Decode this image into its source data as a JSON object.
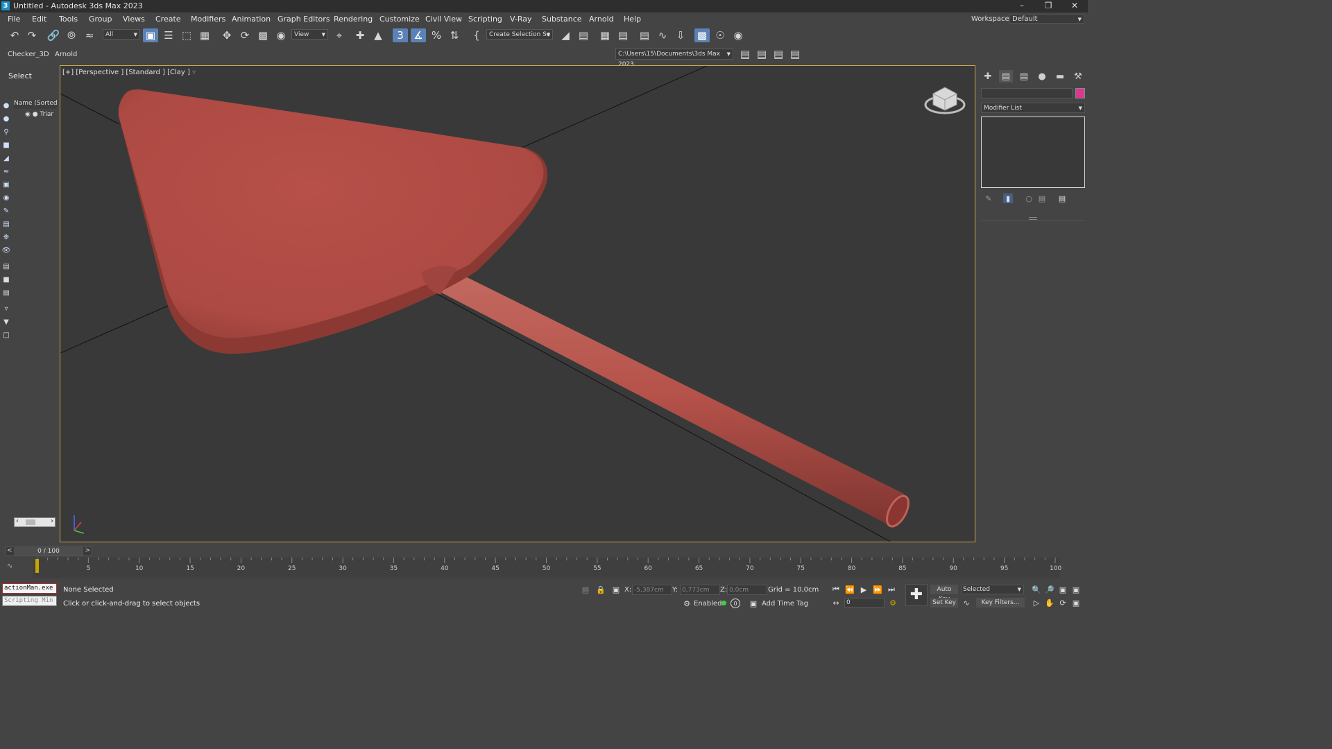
{
  "window": {
    "title": "Untitled - Autodesk 3ds Max 2023",
    "logo": "3",
    "controls": [
      "minimize-icon",
      "restore-icon",
      "close-icon"
    ]
  },
  "menu": {
    "items": [
      "File",
      "Edit",
      "Tools",
      "Group",
      "Views",
      "Create",
      "Modifiers",
      "Animation",
      "Graph Editors",
      "Rendering",
      "Customize",
      "Civil View",
      "Scripting",
      "V-Ray",
      "Substance",
      "Arnold",
      "Help"
    ],
    "workspaces_label": "Workspaces:",
    "workspace_value": "Default"
  },
  "toolbar": {
    "filter_value": "All",
    "refcoord_value": "View",
    "named_selection": "Create Selection Se",
    "snap_value": "3"
  },
  "row2": {
    "tabs": [
      "Checker_3D",
      "Arnold"
    ],
    "project_path": "C:\\Users\\15\\Documents\\3ds Max 2023"
  },
  "scene_explorer": {
    "mode_label": "Select",
    "column_header": "Name (Sorted A",
    "items": [
      "Triar"
    ]
  },
  "viewport": {
    "label": "[+] [Perspective ] [Standard ] [Clay ]",
    "object_color": "#b2524a",
    "border_color": "#c9a64a"
  },
  "command_panel": {
    "modifier_list": "Modifier List",
    "object_color": "#d63a8e"
  },
  "timeline": {
    "current": "0 / 100",
    "ticks": [
      "5",
      "10",
      "15",
      "20",
      "25",
      "30",
      "35",
      "40",
      "45",
      "50",
      "55",
      "60",
      "65",
      "70",
      "75",
      "80",
      "85",
      "90",
      "95",
      "100"
    ],
    "prev": "<",
    "next": ">"
  },
  "statusbar": {
    "maxscript_line1": "actionMan.exe",
    "maxscript_line2": "Scripting Min",
    "selection_status": "None Selected",
    "prompt": "Click or click-and-drag to select objects",
    "x_label": "X:",
    "x_value": "-5,387cm",
    "y_label": "Y:",
    "y_value": "0,773cm",
    "z_label": "Z:",
    "z_value": "0,0cm",
    "grid": "Grid = 10,0cm",
    "enabled_label": "Enabled:",
    "enabled_value": "0",
    "add_time_tag": "Add Time Tag",
    "auto_key": "Auto Key",
    "set_key": "Set Key",
    "key_mode": "Selected",
    "key_filters": "Key Filters...",
    "frame_value": "0"
  }
}
